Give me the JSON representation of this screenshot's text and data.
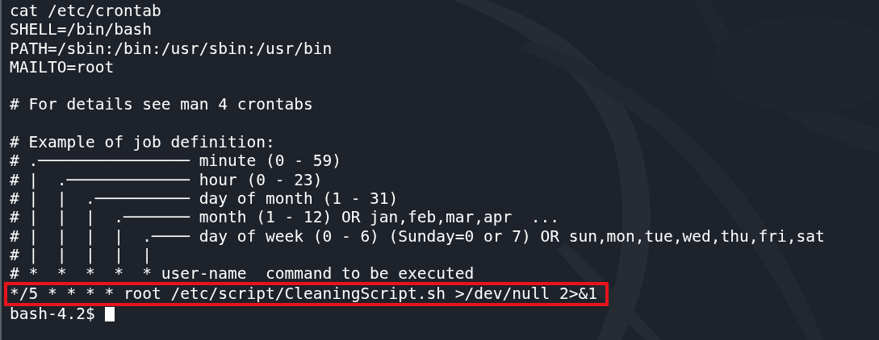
{
  "terminal": {
    "lines": [
      {
        "kind": "text",
        "text": "cat /etc/crontab"
      },
      {
        "kind": "text",
        "text": "SHELL=/bin/bash"
      },
      {
        "kind": "text",
        "text": "PATH=/sbin:/bin:/usr/sbin:/usr/bin"
      },
      {
        "kind": "text",
        "text": "MAILTO=root"
      },
      {
        "kind": "blank"
      },
      {
        "kind": "text",
        "text": "# For details see man 4 crontabs"
      },
      {
        "kind": "blank"
      },
      {
        "kind": "text",
        "text": "# Example of job definition:"
      },
      {
        "kind": "text",
        "text": "# .──────────────── minute (0 - 59)"
      },
      {
        "kind": "text",
        "text": "# |  .───────────── hour (0 - 23)"
      },
      {
        "kind": "text",
        "text": "# |  |  .────────── day of month (1 - 31)"
      },
      {
        "kind": "text",
        "text": "# |  |  |  .─────── month (1 - 12) OR jan,feb,mar,apr  ..."
      },
      {
        "kind": "text",
        "text": "# |  |  |  |  .──── day of week (0 - 6) (Sunday=0 or 7) OR sun,mon,tue,wed,thu,fri,sat"
      },
      {
        "kind": "text",
        "text": "# |  |  |  |  |"
      },
      {
        "kind": "text",
        "text": "# *  *  *  *  * user-name  command to be executed"
      },
      {
        "kind": "highlighted",
        "text": "*/5 * * * * root /etc/script/CleaningScript.sh >/dev/null 2>&1"
      },
      {
        "kind": "prompt",
        "text": "bash-4.2$"
      }
    ]
  }
}
